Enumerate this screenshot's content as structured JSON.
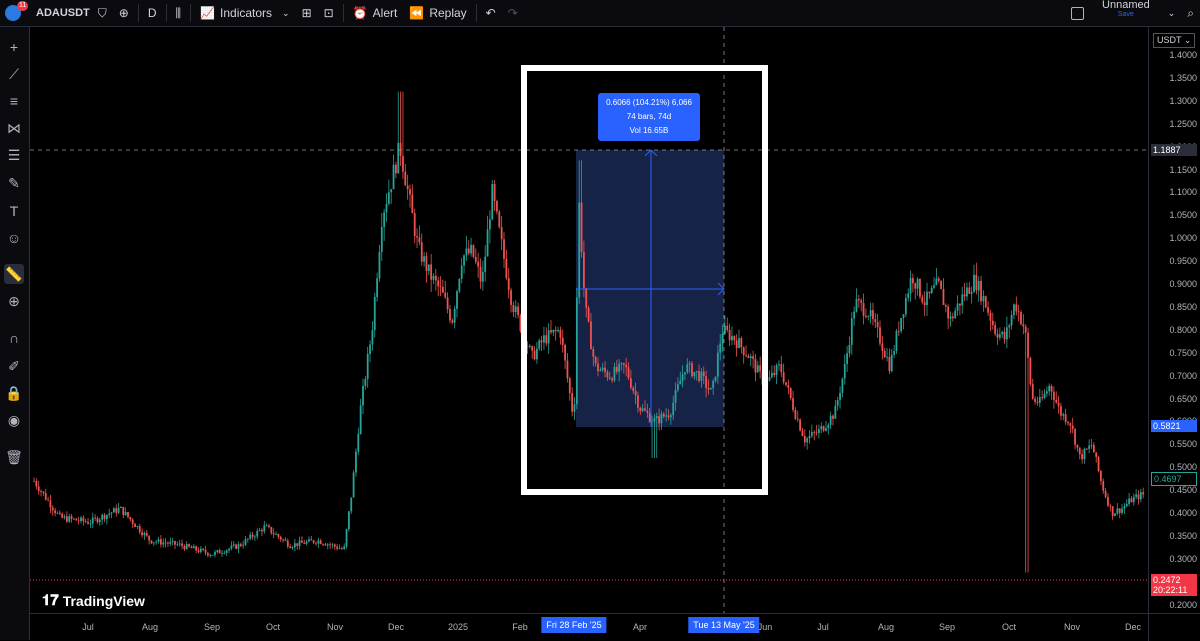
{
  "topbar": {
    "notification_count": "11",
    "symbol": "ADAUSDT",
    "interval": "D",
    "indicators_label": "Indicators",
    "alert_label": "Alert",
    "replay_label": "Replay",
    "layout_name": "Unnamed",
    "save_label": "Save"
  },
  "price_axis": {
    "currency": "USDT",
    "ticks": [
      "1.4000",
      "1.3500",
      "1.3000",
      "1.2500",
      "1.2000",
      "1.1500",
      "1.1000",
      "1.0500",
      "1.0000",
      "0.9500",
      "0.9000",
      "0.8500",
      "0.8000",
      "0.7500",
      "0.7000",
      "0.6500",
      "0.6000",
      "0.5500",
      "0.5000",
      "0.4500",
      "0.4000",
      "0.3500",
      "0.3000",
      "0.2500",
      "0.2000"
    ],
    "crosshair_price": "1.1887",
    "range_low_price": "0.5821",
    "last_price": "0.4697",
    "low_line_price": "0.2472",
    "countdown": "20:22:11"
  },
  "time_axis": {
    "ticks": [
      "Jul",
      "Aug",
      "Sep",
      "Oct",
      "Nov",
      "Dec",
      "2025",
      "Feb",
      "Apr",
      "Jun",
      "Jul",
      "Aug",
      "Sep",
      "Oct",
      "Nov",
      "Dec"
    ],
    "range_start": "Fri 28 Feb '25",
    "range_end": "Tue 13 May '25"
  },
  "measure": {
    "line1": "0.6066 (104.21%) 6,066",
    "line2": "74 bars, 74d",
    "line3": "Vol 16.65B"
  },
  "watermark": "TradingView",
  "colors": {
    "up": "#26a69a",
    "down": "#ef5350",
    "accent": "#2962ff",
    "measure_fill": "#1e2f5e"
  },
  "chart_data": {
    "type": "candlestick",
    "symbol": "ADAUSDT",
    "interval": "D",
    "ylim": [
      0.2,
      1.4
    ],
    "x": [
      "Jun '24",
      "Jul '24",
      "Aug '24",
      "Sep '24",
      "Oct '24",
      "Nov '24",
      "Dec '24",
      "Jan '25",
      "Feb '25",
      "Mar '25",
      "Apr '25",
      "May '25",
      "Jun '25",
      "Jul '25",
      "Aug '25",
      "Sep '25",
      "Oct '25",
      "Nov '25",
      "Dec '25"
    ],
    "close": [
      0.44,
      0.39,
      0.34,
      0.33,
      0.34,
      0.55,
      1.05,
      0.95,
      0.78,
      0.72,
      0.63,
      0.78,
      0.6,
      0.76,
      0.9,
      0.83,
      0.7,
      0.48,
      0.42
    ]
  }
}
